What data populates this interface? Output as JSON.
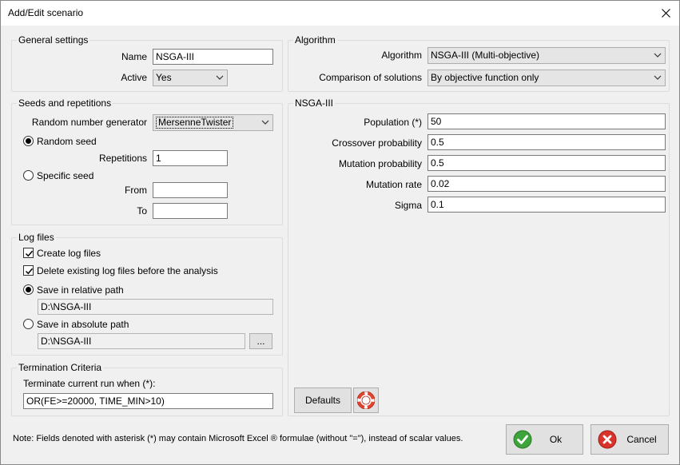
{
  "window": {
    "title": "Add/Edit scenario"
  },
  "general": {
    "legend": "General settings",
    "name_label": "Name",
    "name_value": "NSGA-III",
    "active_label": "Active",
    "active_value": "Yes"
  },
  "seeds": {
    "legend": "Seeds and repetitions",
    "rng_label": "Random number generator",
    "rng_value": "MersenneTwister",
    "random_seed_label": "Random seed",
    "repetitions_label": "Repetitions",
    "repetitions_value": "1",
    "specific_seed_label": "Specific seed",
    "from_label": "From",
    "from_value": "",
    "to_label": "To",
    "to_value": ""
  },
  "log": {
    "legend": "Log files",
    "create_label": "Create log files",
    "delete_label": "Delete existing log files before the analysis",
    "relative_label": "Save in relative path",
    "relative_value": "D:\\NSGA-III",
    "absolute_label": "Save in absolute path",
    "absolute_value": "D:\\NSGA-III",
    "browse_label": "..."
  },
  "termination": {
    "legend": "Termination Criteria",
    "label": "Terminate current run when (*):",
    "value": "OR(FE>=20000, TIME_MIN>10)"
  },
  "algorithm": {
    "legend": "Algorithm",
    "algorithm_label": "Algorithm",
    "algorithm_value": "NSGA-III (Multi-objective)",
    "comparison_label": "Comparison of solutions",
    "comparison_value": "By objective function only"
  },
  "nsga": {
    "legend": "NSGA-III",
    "params": [
      {
        "label": "Population (*)",
        "value": "50"
      },
      {
        "label": "Crossover probability",
        "value": "0.5"
      },
      {
        "label": "Mutation probability",
        "value": "0.5"
      },
      {
        "label": "Mutation rate",
        "value": "0.02"
      },
      {
        "label": "Sigma",
        "value": "0.1"
      }
    ],
    "defaults_label": "Defaults"
  },
  "footer": {
    "note": "Note: Fields denoted with asterisk (*) may contain Microsoft Excel ® formulae (without \"=\"), instead of scalar values.",
    "ok_label": "Ok",
    "cancel_label": "Cancel"
  },
  "icons": {
    "ok": "green-check-icon",
    "cancel": "red-x-icon",
    "help": "lifebuoy-icon",
    "close": "close-icon"
  },
  "colors": {
    "ok_green": "#3da33a",
    "cancel_red": "#d9342b",
    "help_red": "#e0442e"
  }
}
